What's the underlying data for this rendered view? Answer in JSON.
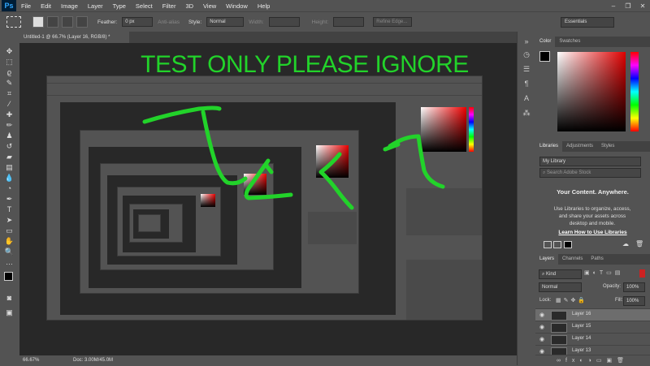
{
  "app": {
    "logo": "Ps"
  },
  "menu": {
    "items": [
      "File",
      "Edit",
      "Image",
      "Layer",
      "Type",
      "Select",
      "Filter",
      "3D",
      "View",
      "Window",
      "Help"
    ]
  },
  "window_controls": {
    "minimize": "–",
    "restore": "❐",
    "close": "✕"
  },
  "options_bar": {
    "feather_label": "Feather:",
    "feather_value": "0 px",
    "antialias_label": "Anti-alias",
    "style_label": "Style:",
    "style_value": "Normal",
    "width_label": "Width:",
    "height_label": "Height:",
    "refine_edge": "Refine Edge...",
    "workspace": "Essentials"
  },
  "document": {
    "tab_title": "Untitled-1 @ 66.7% (Layer 16, RGB/8) *"
  },
  "status_bar": {
    "zoom": "66.67%",
    "doc_info": "Doc: 3.00M/45.0M"
  },
  "annotation": {
    "text": "TEST ONLY PLEASE IGNORE",
    "color": "#22d32a"
  },
  "panels": {
    "color_tabs": [
      "Color",
      "Swatches"
    ],
    "library_tabs": [
      "Libraries",
      "Adjustments",
      "Styles"
    ],
    "library_select": "My Library",
    "library_search": "Search Adobe Stock",
    "library_heading": "Your Content. Anywhere.",
    "library_body": "Use Libraries to organize, access, and share your assets across desktop and mobile.",
    "library_link": "Learn How to Use Libraries",
    "layers_tabs": [
      "Layers",
      "Channels",
      "Paths"
    ],
    "kind_label": "Kind",
    "blend_mode": "Normal",
    "opacity_label": "Opacity:",
    "opacity_value": "100%",
    "lock_label": "Lock:",
    "fill_label": "Fill:",
    "fill_value": "100%",
    "layers": [
      {
        "name": "Layer 16",
        "selected": true
      },
      {
        "name": "Layer 15",
        "selected": false
      },
      {
        "name": "Layer 14",
        "selected": false
      },
      {
        "name": "Layer 13",
        "selected": false
      }
    ]
  },
  "colors": {
    "accent_green": "#22d32a",
    "ui_gray": "#535353",
    "canvas": "#282828"
  }
}
